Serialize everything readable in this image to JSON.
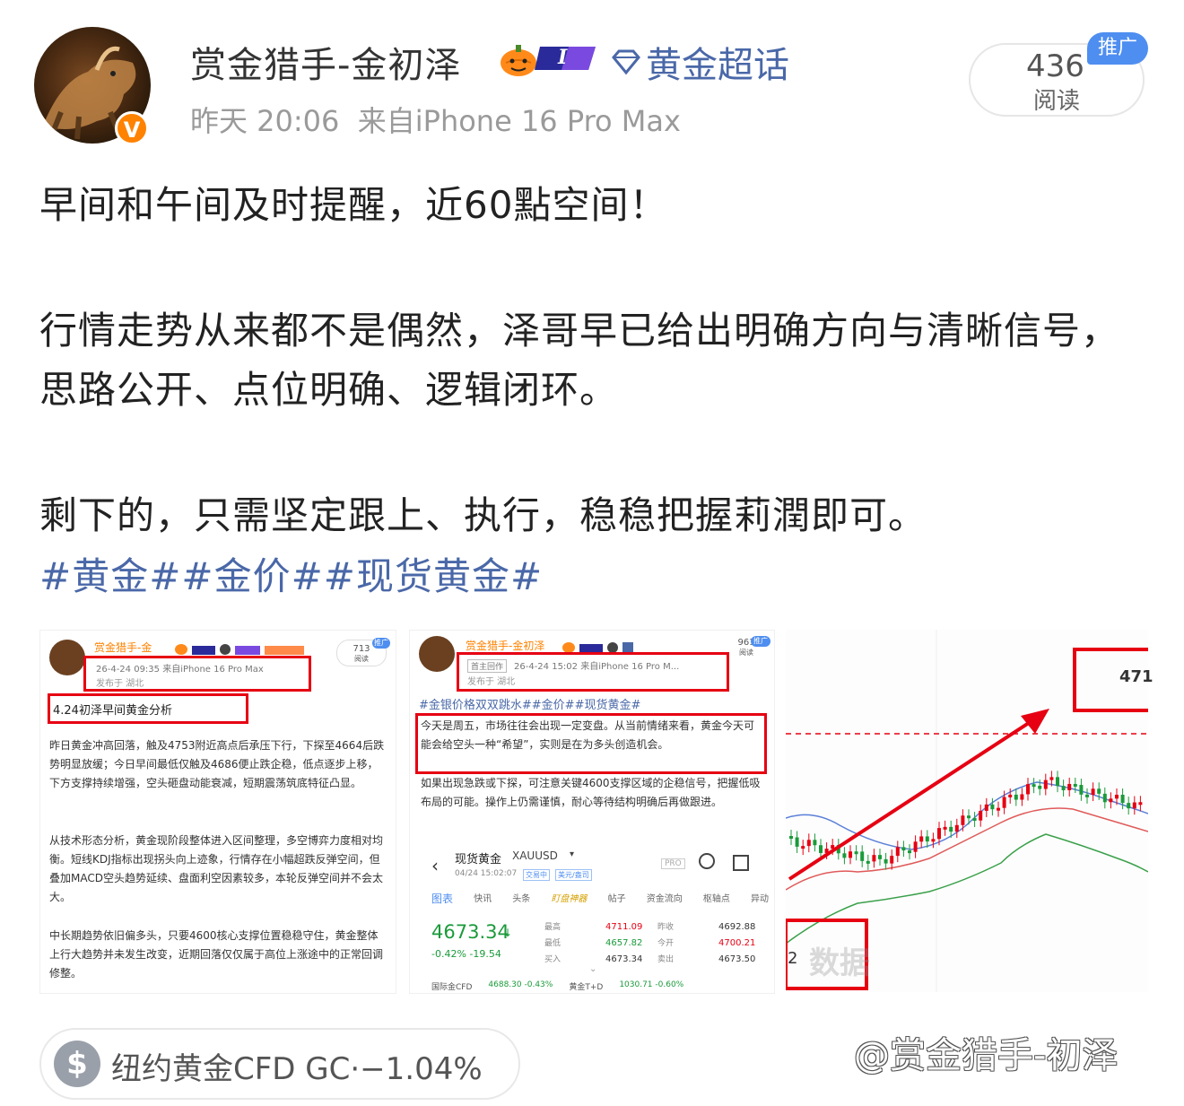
{
  "post": {
    "username": "赏金猎手-金初泽",
    "rank_badge": "I",
    "topic": "黄金超话",
    "time": "昨天 20:06",
    "source": "来自iPhone 16 Pro Max",
    "read_count": "436",
    "read_label": "阅读",
    "promo_label": "推广",
    "verified_mark": "V"
  },
  "content": {
    "line1": "早间和午间及时提醒，近60點空间！",
    "line2": "行情走势从来都不是偶然，泽哥早已给出明确方向与清晰信号，思路公开、点位明确、逻辑闭环。",
    "line3": "剩下的，只需坚定跟上、执行，稳稳把握莉潤即可。",
    "hashtags": "#黄金##金价##现货黄金#"
  },
  "images": {
    "img1": {
      "user": "赏金猎手-金",
      "meta1": "26-4-24 09:35 来自iPhone 16 Pro Max",
      "meta2": "发布于 湖北",
      "views": "713",
      "views_label": "阅读",
      "promo": "推广",
      "title": "4.24初泽早间黄金分析",
      "para1": "昨日黄金冲高回落，触及4753附近高点后承压下行，下探至4664后跌势明显放缓；今日早间最低仅触及4686便止跌企稳，低点逐步上移，下方支撑持续增强，空头砸盘动能衰减，短期震荡筑底特征凸显。",
      "para2": "从技术形态分析，黄金现阶段整体进入区间整理，多空博弈力度相对均衡。短线KDJ指标出现拐头向上迹象，行情存在小幅超跌反弹空间，但叠加MACD空头趋势延续、盘面利空因素较多，本轮反弹空间并不会太大。",
      "para3": "中长期趋势依旧偏多头，只要4600核心支撑位置稳稳守住，黄金整体上行大趋势并未发生改变，近期回落仅仅属于高位上涨途中的正常回调修整。"
    },
    "img2": {
      "user": "赏金猎手-金初泽",
      "meta1": "26-4-24 15:02 来自iPhone 16 Pro M...",
      "meta1_tag": "首主回作",
      "meta2": "发布于 湖北",
      "views": "961",
      "views_label": "阅读",
      "promo": "推广",
      "tags": "#金银价格双双跳水##金价##现货黄金#",
      "para1": "今天是周五，市场往往会出现一定变盘。从当前情绪来看，黄金今天可能会给空头一种“希望”，实则是在为多头创造机会。",
      "para2": "如果出现急跌或下探，可注意关键4600支撑区域的企稳信号，把握低吸布局的可能。操作上仍需谨慎，耐心等待结构明确后再做跟进。",
      "quote_name": "现货黄金",
      "quote_code": "XAUUSD",
      "quote_time": "04/24 15:02:07",
      "quote_status1": "交易中",
      "quote_status2": "美元/盎司",
      "quote_pro": "PRO",
      "tabs": [
        "图表",
        "快讯",
        "头条",
        "盯盘神器",
        "帖子",
        "资金流向",
        "枢轴点",
        "异动"
      ],
      "price": "4673.34",
      "change": "-0.42%  -19.54",
      "stat_labels_a": [
        "最高",
        "最低",
        "买入"
      ],
      "stat_values_a": [
        "4711.09",
        "4657.82",
        "4673.34"
      ],
      "stat_labels_b": [
        "昨收",
        "今开",
        "卖出"
      ],
      "stat_values_b": [
        "4692.88",
        "4700.21",
        "4673.50"
      ],
      "footer": [
        "国际金CFD",
        "4688.30 -0.43%",
        "黄金T+D",
        "1030.71 -0.60%"
      ]
    },
    "img3": {
      "label_top": "471",
      "label_bottom": "2",
      "watermark": "数据"
    }
  },
  "footer": {
    "instrument": "纽约黄金CFD GC",
    "change": "·−1.04%",
    "watermark": "@赏金猎手-初泽"
  },
  "colors": {
    "topic_blue": "#4a68a8",
    "promo_blue": "#4e8ef0",
    "verified_orange": "#ff8200",
    "alert_red": "#e60012",
    "up_red": "#e60012",
    "down_green": "#1a9a3a"
  }
}
